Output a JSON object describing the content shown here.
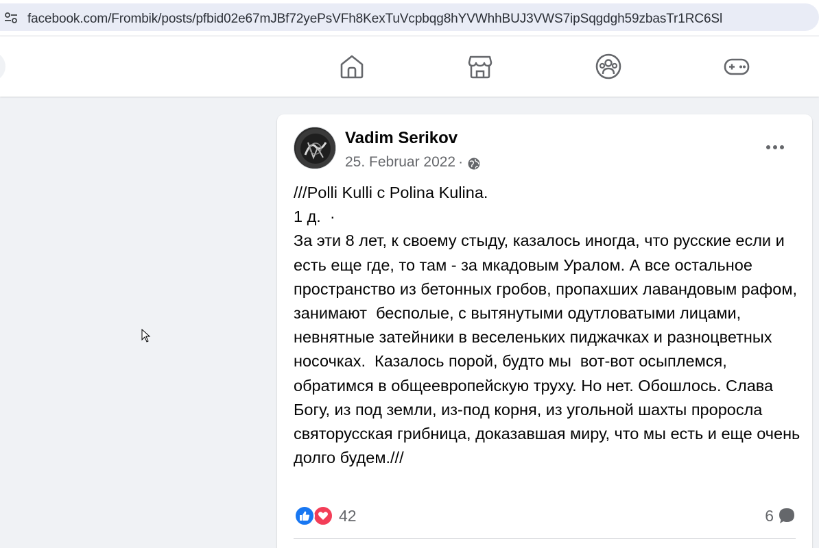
{
  "browser": {
    "url": "facebook.com/Frombik/posts/pfbid02e67mJBf72yePsVFh8KexTuVcpbqg8hYVWhhBUJ3VWS7ipSqgdgh59zbasTr1RC6Sl",
    "site_info_icon": "tune-icon"
  },
  "nav": {
    "tabs": [
      {
        "icon": "home-icon"
      },
      {
        "icon": "marketplace-icon"
      },
      {
        "icon": "groups-icon"
      },
      {
        "icon": "gaming-icon"
      }
    ]
  },
  "post": {
    "author": "Vadim Serikov",
    "date": "25. Februar 2022",
    "separator": "·",
    "audience_icon": "globe-icon",
    "body": "///Polli Kulli с Polina Kulina.\n1 д.  ·\nЗа эти 8 лет, к своему стыду, казалось иногда, что русские если и есть еще где, то там - за мкадовым Уралом. А все остальное пространство из бетонных гробов, пропахших лавандовым рафом, занимают  бесполые, с вытянутыми одутловатыми лицами, невнятные затейники в веселеньких пиджачках и разноцветных носочках.  Казалось порой, будто мы  вот-вот осыплемся, обратимся в общеевропейскую труху. Но нет. Обошлось. Слава Богу, из под земли, из-под корня, из угольной шахты проросла святорусская грибница, доказавшая миру, что мы есть и еще очень долго будем.///",
    "reactions_count": "42",
    "comments_count": "6"
  },
  "colors": {
    "like": "#1877f2",
    "love": "#f33e58",
    "secondary_text": "#65676b",
    "page_bg": "#f0f2f5"
  }
}
